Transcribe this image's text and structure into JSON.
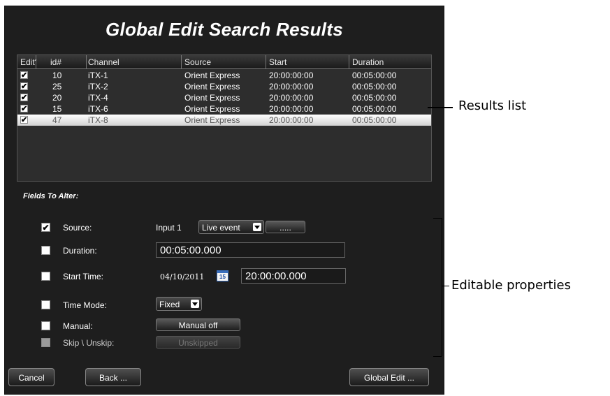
{
  "window": {
    "title": "Global Edit Search Results"
  },
  "table": {
    "columns": [
      "Edit?",
      "id#",
      "Channel",
      "Source",
      "Start",
      "Duration"
    ],
    "rows": [
      {
        "checked": "✔",
        "id": "10",
        "channel": "iTX-1",
        "source": "Orient Express",
        "start": "20:00:00:00",
        "duration": "00:05:00:00"
      },
      {
        "checked": "✔",
        "id": "25",
        "channel": "iTX-2",
        "source": "Orient Express",
        "start": "20:00:00:00",
        "duration": "00:05:00:00"
      },
      {
        "checked": "✔",
        "id": "20",
        "channel": "iTX-4",
        "source": "Orient Express",
        "start": "20:00:00:00",
        "duration": "00:05:00:00"
      },
      {
        "checked": "✔",
        "id": "15",
        "channel": "iTX-6",
        "source": "Orient Express",
        "start": "20:00:00:00",
        "duration": "00:05:00:00"
      },
      {
        "checked": "✔",
        "id": "47",
        "channel": "iTX-8",
        "source": "Orient Express",
        "start": "20:00:00:00",
        "duration": "00:05:00:00"
      }
    ]
  },
  "fields": {
    "title": "Fields To Alter:",
    "source": {
      "label": "Source:",
      "checked": "✔",
      "input_label": "Input 1",
      "dropdown": "Live event",
      "button": "....."
    },
    "duration": {
      "label": "Duration:",
      "value": "00:05:00.000"
    },
    "start_time": {
      "label": "Start Time:",
      "date": "04/10/2011",
      "calendar_day": "15",
      "time": "20:00:00.000"
    },
    "time_mode": {
      "label": "Time Mode:",
      "dropdown": "Fixed"
    },
    "manual": {
      "label": "Manual:",
      "button": "Manual off"
    },
    "skip": {
      "label": "Skip \\ Unskip:",
      "button": "Unskipped"
    }
  },
  "buttons": {
    "cancel": "Cancel",
    "back": "Back ...",
    "global_edit": "Global Edit ..."
  },
  "annotations": {
    "results": "Results list",
    "editable": "Editable properties"
  }
}
